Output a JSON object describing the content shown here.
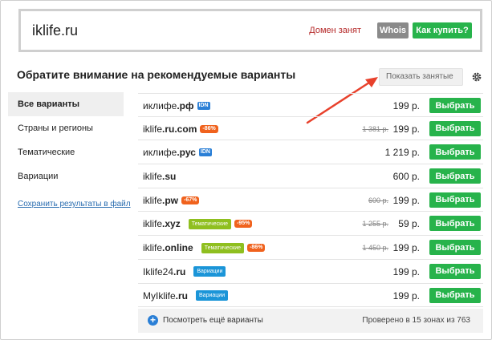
{
  "top": {
    "domain_name": "iklife",
    "domain_zone": ".ru",
    "busy_label": "Домен занят",
    "whois_label": "Whois",
    "howbuy_label": "Как купить?"
  },
  "heading": {
    "title": "Обратите внимание на рекомендуемые варианты",
    "show_busy_placeholder": "Показать занятые",
    "icon": "gear-icon"
  },
  "sidebar": {
    "items": [
      {
        "label": "Все варианты",
        "active": true
      },
      {
        "label": "Страны и регионы",
        "active": false
      },
      {
        "label": "Тематические",
        "active": false
      },
      {
        "label": "Вариации",
        "active": false
      }
    ],
    "save_link": "Сохранить результаты в файл"
  },
  "rows": [
    {
      "name": "иклифе",
      "zone": ".рф",
      "idn": "IDN",
      "discount": "",
      "tag": "",
      "tag_type": "",
      "old_price": "",
      "price": "199 р.",
      "button": "Выбрать"
    },
    {
      "name": "iklife",
      "zone": ".ru.com",
      "idn": "",
      "discount": "-86%",
      "tag": "",
      "tag_type": "",
      "old_price": "1 381 р.",
      "price": "199 р.",
      "button": "Выбрать"
    },
    {
      "name": "иклифе",
      "zone": ".рус",
      "idn": "IDN",
      "discount": "",
      "tag": "",
      "tag_type": "",
      "old_price": "",
      "price": "1 219 р.",
      "button": "Выбрать"
    },
    {
      "name": "iklife",
      "zone": ".su",
      "idn": "",
      "discount": "",
      "tag": "",
      "tag_type": "",
      "old_price": "",
      "price": "600 р.",
      "button": "Выбрать"
    },
    {
      "name": "iklife",
      "zone": ".pw",
      "idn": "",
      "discount": "-67%",
      "tag": "",
      "tag_type": "",
      "old_price": "600 р.",
      "price": "199 р.",
      "button": "Выбрать"
    },
    {
      "name": "iklife",
      "zone": ".xyz",
      "idn": "",
      "discount": "-95%",
      "tag": "Тематические",
      "tag_type": "green",
      "old_price": "1 255 р.",
      "price": "59 р.",
      "button": "Выбрать"
    },
    {
      "name": "iklife",
      "zone": ".online",
      "idn": "",
      "discount": "-86%",
      "tag": "Тематические",
      "tag_type": "green",
      "old_price": "1 450 р.",
      "price": "199 р.",
      "button": "Выбрать"
    },
    {
      "name": "Iklife24",
      "zone": ".ru",
      "idn": "",
      "discount": "",
      "tag": "Вариации",
      "tag_type": "blue",
      "old_price": "",
      "price": "199 р.",
      "button": "Выбрать"
    },
    {
      "name": "MyIklife",
      "zone": ".ru",
      "idn": "",
      "discount": "",
      "tag": "Вариации",
      "tag_type": "blue",
      "old_price": "",
      "price": "199 р.",
      "button": "Выбрать"
    }
  ],
  "footer": {
    "more_label": "Посмотреть ещё варианты",
    "checked_label": "Проверено в 15 зонах из 763"
  },
  "colors": {
    "accent_green": "#27b34b",
    "busy_red": "#b52a2a",
    "discount_orange": "#f0621d",
    "idn_blue": "#2a7fd6",
    "arrow_red": "#e8412c"
  }
}
